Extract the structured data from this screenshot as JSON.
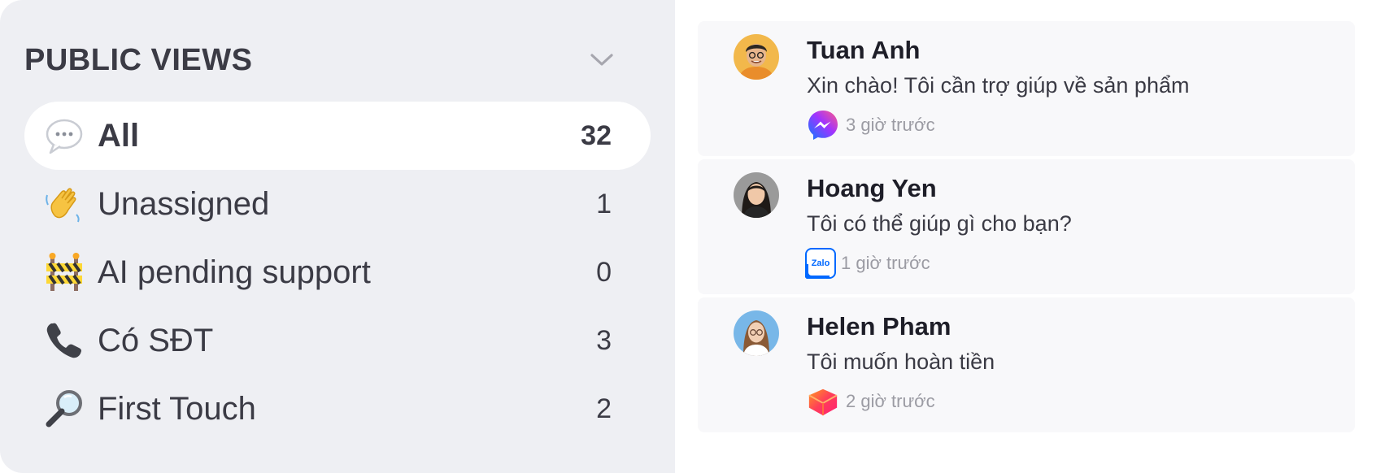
{
  "public_views": {
    "title": "PUBLIC VIEWS",
    "items": [
      {
        "label": "All",
        "count": "32",
        "icon": "speech-bubble-icon",
        "active": true
      },
      {
        "label": "Unassigned",
        "count": "1",
        "icon": "waving-hand-icon"
      },
      {
        "label": "AI pending support",
        "count": "0",
        "icon": "construction-barrier-icon"
      },
      {
        "label": "Có SĐT",
        "count": "3",
        "icon": "telephone-icon"
      },
      {
        "label": "First Touch",
        "count": "2",
        "icon": "magnifying-glass-icon"
      }
    ]
  },
  "conversations": [
    {
      "name": "Tuan Anh",
      "message": "Xin chào! Tôi cần trợ giúp về sản phẩm",
      "time": "3 giờ trước",
      "channel": "messenger-icon"
    },
    {
      "name": "Hoang Yen",
      "message": "Tôi có thể giúp gì cho bạn?",
      "time": "1 giờ trước",
      "channel": "zalo-icon",
      "channel_text": "Zalo"
    },
    {
      "name": "Helen Pham",
      "message": "Tôi muốn hoàn tiền",
      "time": "2 giờ trước",
      "channel": "lazada-icon"
    }
  ],
  "colors": {
    "panel_bg": "#eeeff3",
    "text_dark": "#3b3b45",
    "muted": "#9b9ba3",
    "card_bg": "#f8f8fa"
  }
}
